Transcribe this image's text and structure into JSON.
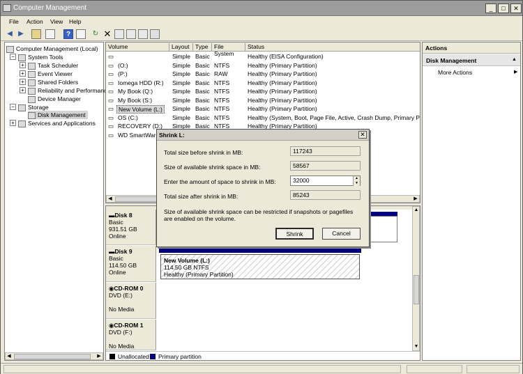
{
  "window": {
    "title": "Computer Management"
  },
  "menu": [
    "File",
    "Action",
    "View",
    "Help"
  ],
  "tree": {
    "root": "Computer Management (Local)",
    "system_tools": "System Tools",
    "task_scheduler": "Task Scheduler",
    "event_viewer": "Event Viewer",
    "shared_folders": "Shared Folders",
    "reliability": "Reliability and Performanc",
    "device_manager": "Device Manager",
    "storage": "Storage",
    "disk_management": "Disk Management",
    "services": "Services and Applications"
  },
  "volumes": {
    "headers": [
      "Volume",
      "Layout",
      "Type",
      "File System",
      "Status"
    ],
    "rows": [
      [
        "",
        "Simple",
        "Basic",
        "",
        "Healthy (EISA Configuration)"
      ],
      [
        "(O:)",
        "Simple",
        "Basic",
        "NTFS",
        "Healthy (Primary Partition)"
      ],
      [
        "(P:)",
        "Simple",
        "Basic",
        "RAW",
        "Healthy (Primary Partition)"
      ],
      [
        "Iomega HDD (R:)",
        "Simple",
        "Basic",
        "NTFS",
        "Healthy (Primary Partition)"
      ],
      [
        "My Book (Q:)",
        "Simple",
        "Basic",
        "NTFS",
        "Healthy (Primary Partition)"
      ],
      [
        "My Book (S:)",
        "Simple",
        "Basic",
        "NTFS",
        "Healthy (Primary Partition)"
      ],
      [
        "New Volume (L:)",
        "Simple",
        "Basic",
        "NTFS",
        "Healthy (Primary Partition)"
      ],
      [
        "OS (C:)",
        "Simple",
        "Basic",
        "NTFS",
        "Healthy (System, Boot, Page File, Active, Crash Dump, Primary Parti"
      ],
      [
        "RECOVERY (D:)",
        "Simple",
        "Basic",
        "NTFS",
        "Healthy (Primary Partition)"
      ],
      [
        "WD SmartWare",
        "",
        "",
        "",
        ""
      ]
    ]
  },
  "disks": {
    "disk8": {
      "name": "Disk 8",
      "type": "Basic",
      "size": "931.51 GB",
      "state": "Online"
    },
    "disk9": {
      "name": "Disk 9",
      "type": "Basic",
      "size": "114.50 GB",
      "state": "Online",
      "part_name": "New Volume  (L:)",
      "part_size": "114.50 GB NTFS",
      "part_status": "Healthy (Primary Partition)"
    },
    "cd0": {
      "name": "CD-ROM 0",
      "drive": "DVD (E:)",
      "media": "No Media"
    },
    "cd1": {
      "name": "CD-ROM 1",
      "drive": "DVD (F:)",
      "media": "No Media"
    }
  },
  "legend": {
    "unallocated": "Unallocated",
    "primary": "Primary partition"
  },
  "actions": {
    "header": "Actions",
    "section": "Disk Management",
    "more": "More Actions"
  },
  "dialog": {
    "title": "Shrink L:",
    "total_before_label": "Total size before shrink in MB:",
    "total_before": "117243",
    "available_label": "Size of available shrink space in MB:",
    "available": "58567",
    "amount_label": "Enter the amount of space to shrink in MB:",
    "amount": "32000",
    "total_after_label": "Total size after shrink in MB:",
    "total_after": "85243",
    "note_line1": "Size of available shrink space can be restricted if snapshots or pagefiles",
    "note_line2": "are enabled on the volume.",
    "shrink_button": "Shrink",
    "cancel_button": "Cancel"
  },
  "colors": {
    "primary_partition": "#00007f",
    "unallocated": "#000000",
    "accent": "#9c9c9c"
  }
}
